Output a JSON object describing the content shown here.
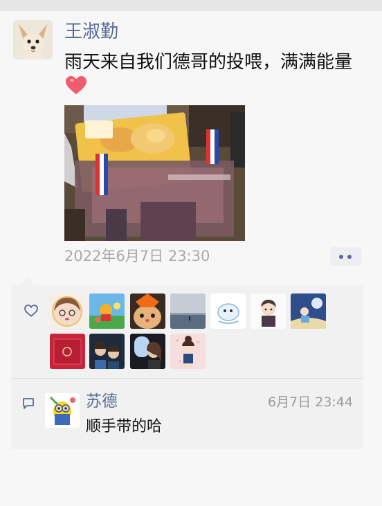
{
  "post": {
    "author": "王淑勤",
    "text": "雨天来自我们德哥的投喂，满满能量",
    "time": "2022年6月7日 23:30"
  },
  "likes": {
    "icon": "heart-outline-icon",
    "count_avatars": 11
  },
  "comments": [
    {
      "author": "苏德",
      "time": "6月7日 23:44",
      "text": "顺手带的哈"
    }
  ],
  "colors": {
    "name_link": "#576b95",
    "time_gray": "#a8a8a8",
    "panel_bg": "#f1f1f1",
    "emoji_heart": "#f05b6e"
  }
}
